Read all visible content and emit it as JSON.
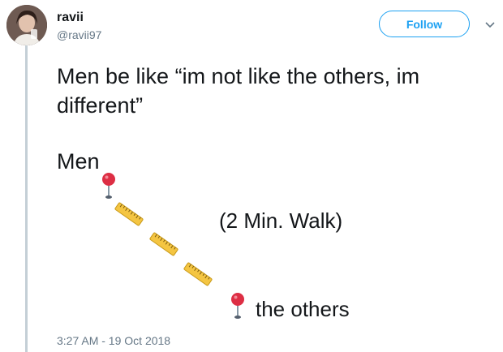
{
  "user": {
    "name": "ravii",
    "handle": "@ravii97"
  },
  "actions": {
    "follow_label": "Follow"
  },
  "tweet": {
    "text": "Men be like “im not like the others, im different”",
    "men_label": "Men",
    "walk_label": "(2 Min. Walk)",
    "others_label": "the others",
    "timestamp": "3:27 AM - 19 Oct 2018"
  },
  "colors": {
    "accent": "#1da1f2",
    "text": "#14171a",
    "secondary": "#657786",
    "pin_head": "#dd2e44",
    "ruler": "#f4c542"
  },
  "icons": [
    "round-pushpin-icon",
    "straight-ruler-icon",
    "chevron-down-icon"
  ]
}
